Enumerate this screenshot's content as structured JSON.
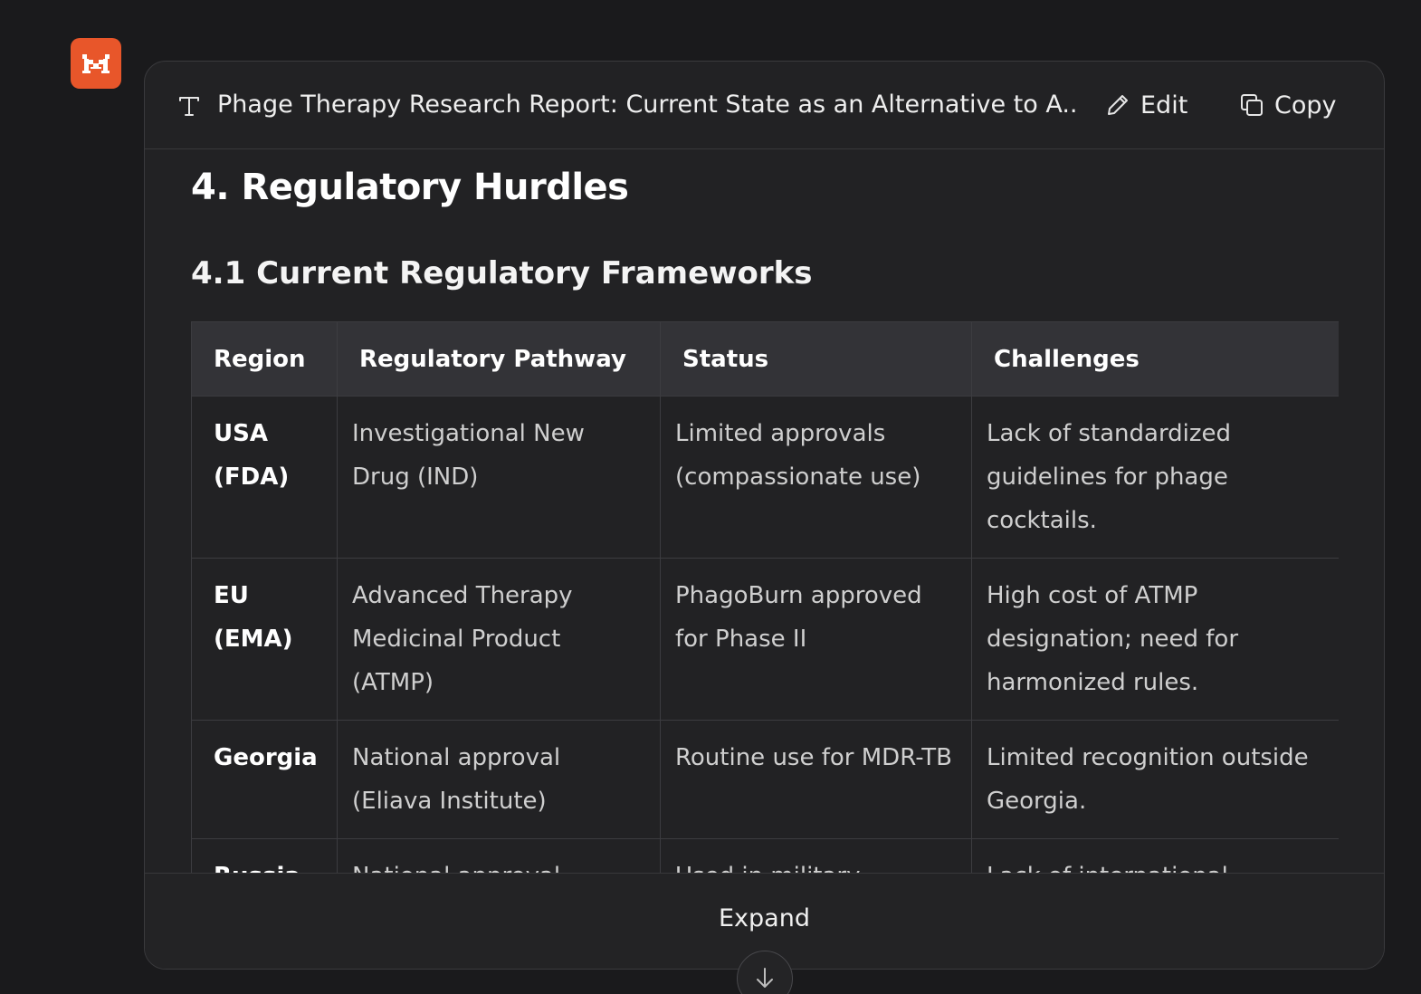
{
  "header": {
    "title": "Phage Therapy Research Report: Current State as an Alternative to A...",
    "edit_label": "Edit",
    "copy_label": "Copy"
  },
  "content": {
    "section_title": "4. Regulatory Hurdles",
    "subsection_title": "4.1 Current Regulatory Frameworks",
    "table": {
      "headers": [
        "Region",
        "Regulatory Pathway",
        "Status",
        "Challenges"
      ],
      "rows": [
        [
          "USA (FDA)",
          "Investigational New Drug (IND)",
          "Limited approvals (compassionate use)",
          "Lack of standardized guidelines for phage cocktails."
        ],
        [
          "EU (EMA)",
          "Advanced Therapy Medicinal Product (ATMP)",
          "PhagoBurn approved for Phase II",
          "High cost of ATMP designation; need for harmonized rules."
        ],
        [
          "Georgia",
          "National approval (Eliava Institute)",
          "Routine use for MDR-TB",
          "Limited recognition outside Georgia."
        ],
        [
          "Russia",
          "National approval",
          "Used in military",
          "Lack of international"
        ]
      ]
    }
  },
  "footer": {
    "expand_label": "Expand"
  },
  "colors": {
    "background": "#1a1a1c",
    "card": "#222224",
    "logo": "#e8562a",
    "table_header": "#333337"
  },
  "icons": {
    "logo": "app-logo-icon",
    "document": "text-format-icon",
    "edit": "pencil-icon",
    "copy": "copy-icon",
    "expand": "arrow-down-icon"
  }
}
